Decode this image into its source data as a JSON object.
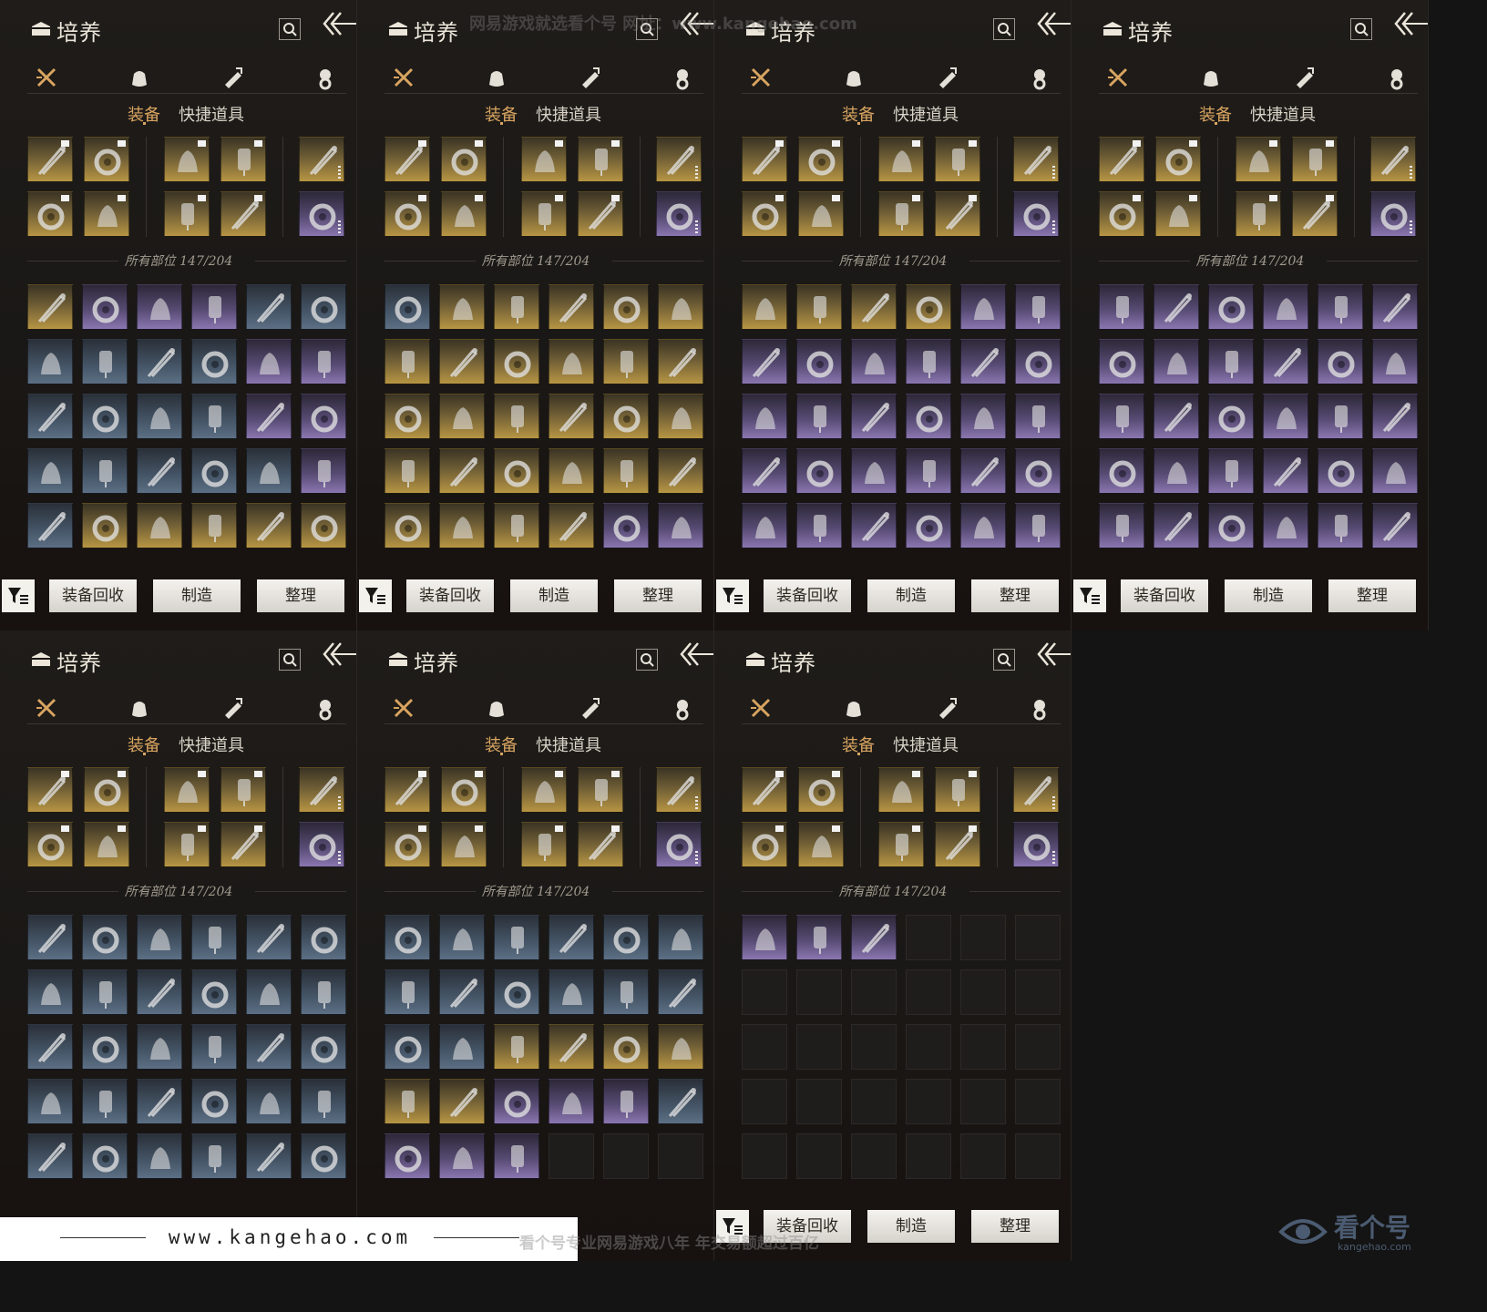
{
  "panel": {
    "title": "培养",
    "subtabs": [
      "装备",
      "快捷道具"
    ],
    "count_label": "所有部位 147/204",
    "buttons": [
      "装备回收",
      "制造",
      "整理"
    ],
    "categories": [
      "weapon-icon",
      "pouch-icon",
      "scroll-icon",
      "token-icon"
    ]
  },
  "equipped_rarity": [
    "gold",
    "gold",
    "gold",
    "gold",
    "gold",
    "gold",
    "gold",
    "gold",
    "gold",
    "purple"
  ],
  "panels": [
    {
      "grid": [
        "gold",
        "purple",
        "purple",
        "purple",
        "blue",
        "blue",
        "blue",
        "blue",
        "blue",
        "blue",
        "purple",
        "purple",
        "blue",
        "blue",
        "blue",
        "blue",
        "purple",
        "purple",
        "blue",
        "blue",
        "blue",
        "blue",
        "blue",
        "purple",
        "blue",
        "gold",
        "gold",
        "gold",
        "gold",
        "gold",
        "blue",
        "blue",
        "blue",
        "blue",
        "blue",
        "blue"
      ],
      "show_bar": true
    },
    {
      "grid": [
        "blue",
        "gold",
        "gold",
        "gold",
        "gold",
        "gold",
        "gold",
        "gold",
        "gold",
        "gold",
        "gold",
        "gold",
        "gold",
        "gold",
        "gold",
        "gold",
        "gold",
        "gold",
        "gold",
        "gold",
        "gold",
        "gold",
        "gold",
        "gold",
        "gold",
        "gold",
        "gold",
        "gold",
        "purple",
        "purple",
        "gold",
        "gold",
        "gold",
        "gold",
        "gold",
        "gold"
      ],
      "show_bar": true
    },
    {
      "grid": [
        "gold",
        "gold",
        "gold",
        "gold",
        "purple",
        "purple",
        "purple",
        "purple",
        "purple",
        "purple",
        "purple",
        "purple",
        "purple",
        "purple",
        "purple",
        "purple",
        "purple",
        "purple",
        "purple",
        "purple",
        "purple",
        "purple",
        "purple",
        "purple",
        "purple",
        "purple",
        "purple",
        "purple",
        "purple",
        "purple",
        "purple",
        "purple",
        "purple",
        "purple",
        "purple",
        "purple"
      ],
      "show_bar": true
    },
    {
      "grid": [
        "purple",
        "purple",
        "purple",
        "purple",
        "purple",
        "purple",
        "purple",
        "purple",
        "purple",
        "purple",
        "purple",
        "purple",
        "purple",
        "purple",
        "purple",
        "purple",
        "purple",
        "purple",
        "purple",
        "purple",
        "purple",
        "purple",
        "purple",
        "purple",
        "purple",
        "purple",
        "purple",
        "purple",
        "purple",
        "purple",
        "purple",
        "purple",
        "purple",
        "purple",
        "purple",
        "purple"
      ],
      "show_bar": true
    },
    {
      "grid": [
        "blue",
        "blue",
        "blue",
        "blue",
        "blue",
        "blue",
        "blue",
        "blue",
        "blue",
        "blue",
        "blue",
        "blue",
        "blue",
        "blue",
        "blue",
        "blue",
        "blue",
        "blue",
        "blue",
        "blue",
        "blue",
        "blue",
        "blue",
        "blue",
        "blue",
        "blue",
        "blue",
        "blue",
        "blue",
        "blue",
        "blue",
        "blue",
        "blue",
        "blue",
        "blue",
        "blue"
      ],
      "show_bar": false
    },
    {
      "grid": [
        "blue",
        "blue",
        "blue",
        "blue",
        "blue",
        "blue",
        "blue",
        "blue",
        "blue",
        "blue",
        "blue",
        "blue",
        "blue",
        "blue",
        "gold",
        "gold",
        "gold",
        "gold",
        "gold",
        "gold",
        "purple",
        "purple",
        "purple",
        "blue",
        "purple",
        "purple",
        "purple",
        "empty",
        "empty",
        "empty",
        "empty",
        "empty",
        "empty",
        "empty",
        "empty",
        "empty"
      ],
      "show_bar": false
    },
    {
      "grid": [
        "purple",
        "purple",
        "purple",
        "empty",
        "empty",
        "empty",
        "empty",
        "empty",
        "empty",
        "empty",
        "empty",
        "empty",
        "empty",
        "empty",
        "empty",
        "empty",
        "empty",
        "empty",
        "empty",
        "empty",
        "empty",
        "empty",
        "empty",
        "empty",
        "empty",
        "empty",
        "empty",
        "empty",
        "empty",
        "empty",
        "empty",
        "empty",
        "empty",
        "empty",
        "empty",
        "empty"
      ],
      "show_bar": true
    }
  ],
  "watermarks": {
    "top": "网易游戏就选看个号   网址：www.kangehao.com",
    "footer_url": "www.kangehao.com",
    "bottom": "看个号专业网易游戏八年 年交易额超过百亿",
    "logo_name": "看个号",
    "logo_sub": "kangehao.com"
  },
  "colors": {
    "accent": "#d8a460",
    "gold": "#b79543",
    "purple": "#8a76b0",
    "blue": "#5c6f84"
  }
}
